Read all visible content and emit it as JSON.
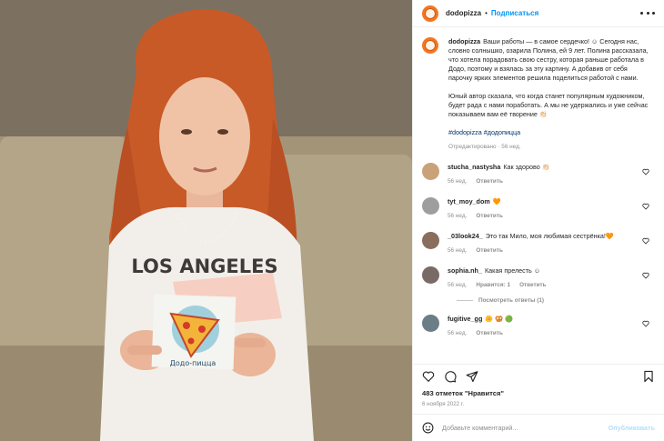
{
  "colors": {
    "accent": "#0095f6",
    "brand": "#f37623",
    "muted": "#8e8e8e",
    "heart": "#ed4956"
  },
  "photo": {
    "shirt_text": "LOS ANGELES",
    "card_text": "Додо-пицца",
    "alt": "Девочка держит рисунок с пиццей"
  },
  "header": {
    "username": "dodopizza",
    "separator": "•",
    "follow_label": "Подписаться",
    "more_icon": "more-horizontal-icon"
  },
  "caption": {
    "username": "dodopizza",
    "paragraph1": "Ваши работы — в самое сердечко! ☺  Сегодня нас, словно солнышко, озарила Полина, ей 9 лет. Полина рассказала, что хотела порадовать свою сестру, которая раньше работала в Додо, поэтому и взялась за эту картину. А добавив от себя парочку ярких элементов решила поделиться работой с нами.",
    "paragraph2": "Юный автор сказала, что когда станет популярным художником, будет рада с нами поработать. А мы не удержались и уже сейчас показываем вам её творение 👏🏻",
    "hashtags": "#dodopizza #додопицца",
    "meta": "Отредактировано · 56 нед."
  },
  "comments": [
    {
      "username": "stucha_nastysha",
      "text": "Как здорово 👏🏻",
      "time": "56 нед.",
      "reply": "Ответить",
      "likes": "",
      "avatar_color": "#c9a27a"
    },
    {
      "username": "tyt_moy_dom",
      "text": "🧡",
      "time": "56 нед.",
      "reply": "Ответить",
      "likes": "",
      "avatar_color": "#9e9e9e"
    },
    {
      "username": "_03look24_",
      "text": "Это так Мило, моя любимая сестрёнка!🧡",
      "time": "56 нед.",
      "reply": "Ответить",
      "likes": "",
      "avatar_color": "#8a6d5c"
    },
    {
      "username": "sophia.nh_",
      "text": "Какая прелесть ☺",
      "time": "56 нед.",
      "reply": "Ответить",
      "likes": "Нравится: 1",
      "avatar_color": "#7a6a66",
      "view_replies": "Посмотреть ответы (1)"
    },
    {
      "username": "fugitive_gg",
      "text": "🌼 🥨 🟢",
      "time": "56 нед.",
      "reply": "Ответить",
      "likes": "",
      "avatar_color": "#6b7d86"
    }
  ],
  "actions": {
    "like_icon": "heart-icon",
    "comment_icon": "comment-icon",
    "share_icon": "send-icon",
    "save_icon": "bookmark-icon"
  },
  "likes_text": "483 отметок \"Нравится\"",
  "date_text": "6 ноября 2022 г.",
  "add_comment": {
    "emoji_icon": "smiley-icon",
    "placeholder": "Добавьте комментарий...",
    "post_label": "Опубликовать"
  }
}
